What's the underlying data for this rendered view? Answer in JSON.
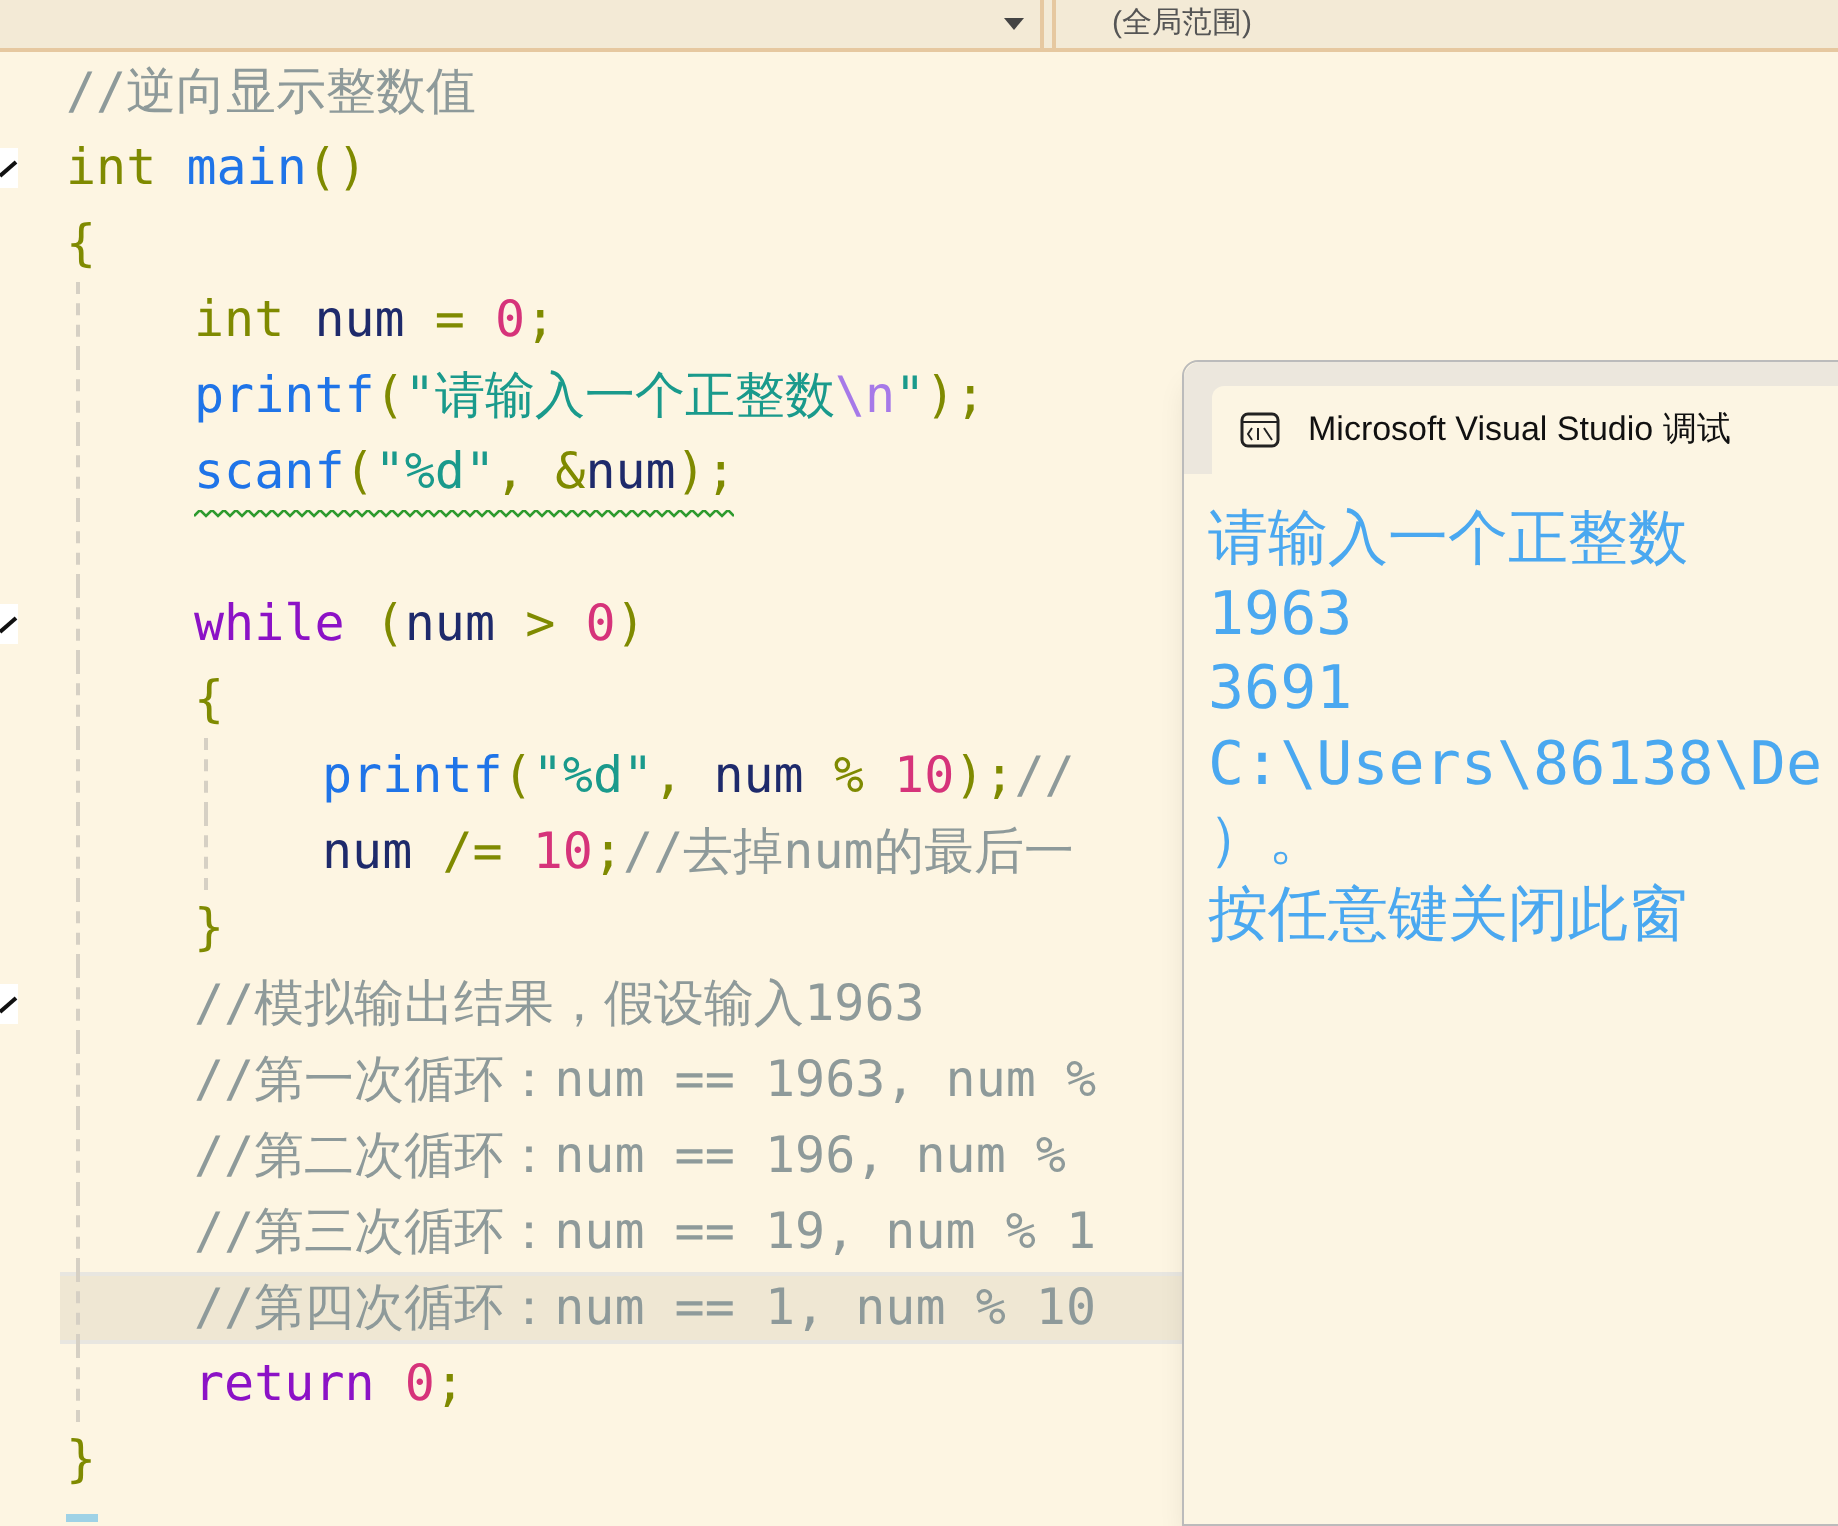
{
  "toolbar": {
    "right_dropdown": {
      "value": "(全局范围)"
    }
  },
  "editor": {
    "lines": [
      {
        "tokens": [
          {
            "kind": "comment",
            "text": "//逆向显示整数值"
          }
        ]
      },
      {
        "fold": true,
        "tokens": [
          {
            "kind": "type",
            "text": "int"
          },
          {
            "kind": "function",
            "text": " main"
          },
          {
            "kind": "punct",
            "text": "()"
          }
        ]
      },
      {
        "tokens": [
          {
            "kind": "punct",
            "text": "{"
          }
        ],
        "children": [
          {
            "tokens": [
              {
                "kind": "type",
                "text": "int"
              },
              {
                "kind": "identifier",
                "text": " num"
              },
              {
                "kind": "punct",
                "text": " = "
              },
              {
                "kind": "number",
                "text": "0"
              },
              {
                "kind": "punct",
                "text": ";"
              }
            ]
          },
          {
            "tokens": [
              {
                "kind": "function",
                "text": "printf"
              },
              {
                "kind": "punct",
                "text": "("
              },
              {
                "kind": "string",
                "text": "\"请输入一个正整数"
              },
              {
                "kind": "escape",
                "text": "\\n"
              },
              {
                "kind": "string",
                "text": "\""
              },
              {
                "kind": "punct",
                "text": ");"
              }
            ]
          },
          {
            "warning": true,
            "blank_line_after": true,
            "tokens": [
              {
                "kind": "function",
                "text": "scanf"
              },
              {
                "kind": "punct",
                "text": "("
              },
              {
                "kind": "string",
                "text": "\"%d\""
              },
              {
                "kind": "punct",
                "text": ", &"
              },
              {
                "kind": "identifier",
                "text": "num"
              },
              {
                "kind": "punct",
                "text": ");"
              }
            ]
          },
          {
            "fold": true,
            "tokens": [
              {
                "kind": "control",
                "text": "while"
              },
              {
                "kind": "punct",
                "text": " ("
              },
              {
                "kind": "identifier",
                "text": "num"
              },
              {
                "kind": "punct",
                "text": " > "
              },
              {
                "kind": "number",
                "text": "0"
              },
              {
                "kind": "punct",
                "text": ")"
              }
            ]
          },
          {
            "tokens": [
              {
                "kind": "punct",
                "text": "{"
              }
            ],
            "children": [
              {
                "tokens": [
                  {
                    "kind": "function",
                    "text": "printf"
                  },
                  {
                    "kind": "punct",
                    "text": "("
                  },
                  {
                    "kind": "string",
                    "text": "\"%d\""
                  },
                  {
                    "kind": "punct",
                    "text": ", "
                  },
                  {
                    "kind": "identifier",
                    "text": "num"
                  },
                  {
                    "kind": "punct",
                    "text": " % "
                  },
                  {
                    "kind": "number",
                    "text": "10"
                  },
                  {
                    "kind": "punct",
                    "text": ");"
                  },
                  {
                    "kind": "comment",
                    "text": "//"
                  }
                ]
              },
              {
                "tokens": [
                  {
                    "kind": "identifier",
                    "text": "num"
                  },
                  {
                    "kind": "punct",
                    "text": " /= "
                  },
                  {
                    "kind": "number",
                    "text": "10"
                  },
                  {
                    "kind": "punct",
                    "text": ";"
                  },
                  {
                    "kind": "comment",
                    "text": "//去掉num的最后一"
                  }
                ]
              }
            ]
          },
          {
            "tokens": [
              {
                "kind": "punct",
                "text": "}"
              }
            ]
          },
          {
            "fold": true,
            "tokens": [
              {
                "kind": "comment",
                "text": "//模拟输出结果，假设输入1963"
              }
            ]
          },
          {
            "tokens": [
              {
                "kind": "comment",
                "text": "//第一次循环：num == 1963, num %"
              }
            ]
          },
          {
            "tokens": [
              {
                "kind": "comment",
                "text": "//第二次循环：num == 196, num %"
              }
            ]
          },
          {
            "tokens": [
              {
                "kind": "comment",
                "text": "//第三次循环：num == 19, num % 1"
              }
            ]
          },
          {
            "current": true,
            "tokens": [
              {
                "kind": "comment",
                "text": "//第四次循环：num == 1, num % 10"
              }
            ]
          },
          {
            "tokens": [
              {
                "kind": "control",
                "text": "return"
              },
              {
                "kind": "number",
                "text": " 0"
              },
              {
                "kind": "punct",
                "text": ";"
              }
            ]
          }
        ]
      },
      {
        "caret": true,
        "tokens": [
          {
            "kind": "punct",
            "text": "}"
          }
        ]
      }
    ]
  },
  "console": {
    "title": "Microsoft Visual Studio 调试",
    "lines": [
      "请输入一个正整数",
      "1963",
      "3691",
      "C:\\Users\\86138\\De",
      "）。",
      "按任意键关闭此窗"
    ]
  }
}
